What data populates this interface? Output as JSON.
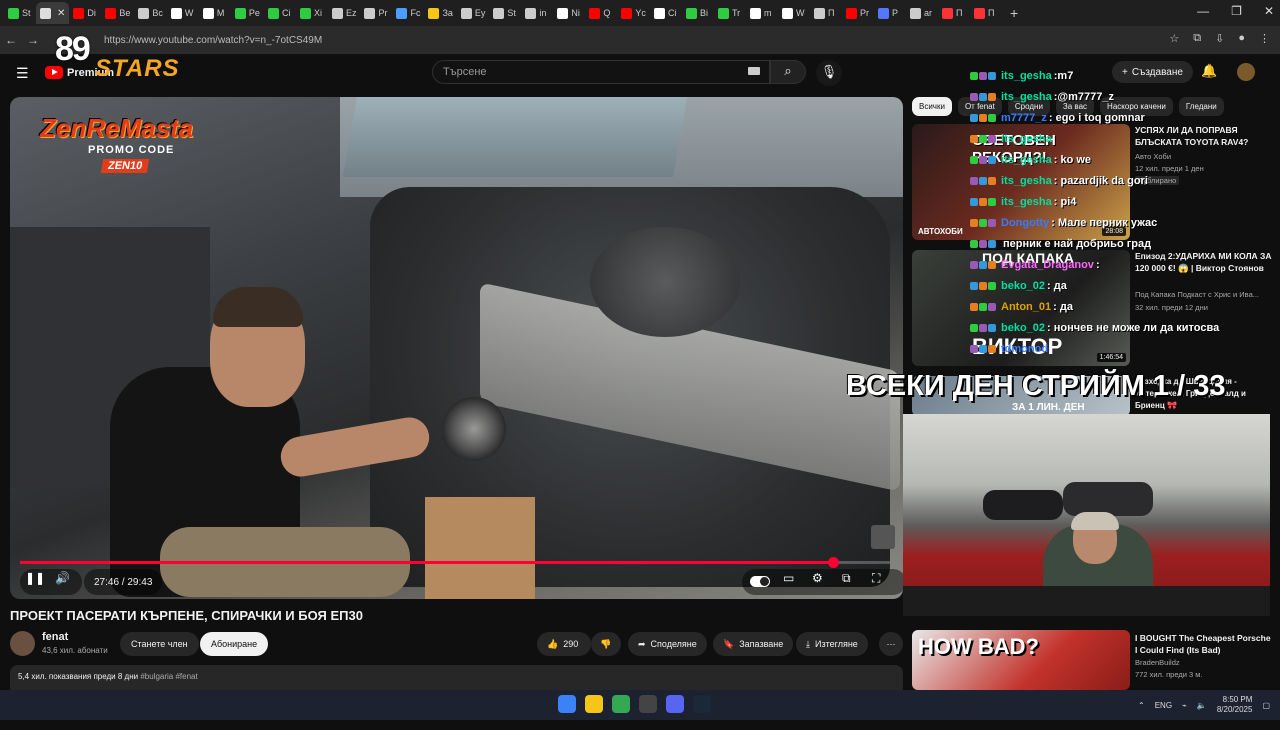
{
  "browser": {
    "tabs": [
      {
        "label": "St",
        "color": "#2ecc40"
      },
      {
        "label": "",
        "color": "#dddddd",
        "active": true
      },
      {
        "label": "Di",
        "color": "#ff0000"
      },
      {
        "label": "Be",
        "color": "#ff0000"
      },
      {
        "label": "Bc",
        "color": "#cccccc"
      },
      {
        "label": "W",
        "color": "#ffffff"
      },
      {
        "label": "M",
        "color": "#ffffff"
      },
      {
        "label": "Pe",
        "color": "#2ecc40"
      },
      {
        "label": "Ci",
        "color": "#2ecc40"
      },
      {
        "label": "Xi",
        "color": "#2ecc40"
      },
      {
        "label": "Ez",
        "color": "#cccccc"
      },
      {
        "label": "Pr",
        "color": "#cccccc"
      },
      {
        "label": "Fc",
        "color": "#4a9eff"
      },
      {
        "label": "За",
        "color": "#f5c518"
      },
      {
        "label": "Ey",
        "color": "#cccccc"
      },
      {
        "label": "St",
        "color": "#cccccc"
      },
      {
        "label": "in",
        "color": "#cccccc"
      },
      {
        "label": "Ni",
        "color": "#ffffff"
      },
      {
        "label": "Q",
        "color": "#ff0000"
      },
      {
        "label": "Yc",
        "color": "#ff0000"
      },
      {
        "label": "Ci",
        "color": "#ffffff"
      },
      {
        "label": "Bi",
        "color": "#2ecc40"
      },
      {
        "label": "Tr",
        "color": "#2ecc40"
      },
      {
        "label": "m",
        "color": "#ffffff"
      },
      {
        "label": "W",
        "color": "#ffffff"
      },
      {
        "label": "П",
        "color": "#cccccc"
      },
      {
        "label": "Pr",
        "color": "#ff0000"
      },
      {
        "label": "Р",
        "color": "#5577ff"
      },
      {
        "label": "ar",
        "color": "#cccccc"
      },
      {
        "label": "П",
        "color": "#ff3333"
      },
      {
        "label": "П",
        "color": "#ff3333"
      }
    ],
    "url": "https://www.youtube.com/watch?v=n_-7otCS49M"
  },
  "youtube": {
    "logo_text": "Premium",
    "search_placeholder": "Търсене",
    "create_label": "Създаване"
  },
  "stream_overlay": {
    "logo_number": "89",
    "logo_word": "STARS",
    "promo_title": "ZenReMasta",
    "promo_sub": "PROMO CODE",
    "promo_code": "ZEN10",
    "banner": "ВСЕКИ ДЕН СТРИЙМ 1 / 33"
  },
  "player": {
    "time": "27:46 / 29:43",
    "progress_fraction": 0.934
  },
  "video": {
    "title": "ПРОЕКТ ПАСЕРАТИ КЪРПЕНЕ, СПИРАЧКИ И БОЯ ЕП30",
    "channel": "fenat",
    "subscribers": "43,6 хил. абонати",
    "join_label": "Станете член",
    "subscribe_label": "Абониране",
    "likes": "290",
    "share_label": "Споделяне",
    "save_label": "Запазване",
    "download_label": "Изтегляне",
    "views": "5,4 хил. показвания  преди 8 дни",
    "hashtags": "#bulgaria #fenat"
  },
  "sidebar": {
    "chips": [
      "Всички",
      "От fenat",
      "Сродни",
      "За вас",
      "Наскоро качени",
      "Гледани"
    ],
    "recs": [
      {
        "title": "УСПЯХ ЛИ ДА ПОПРАВЯ БЛЪСКАТА TOYOTA RAV4?",
        "channel": "Авто Хоби",
        "meta": "12 хил.  преди 1 ден",
        "badge": "Дублирано",
        "duration": "28:08",
        "thumb_text": "СВЕТОВЕН РЕКОРД?!",
        "thumb_label": "АВТОХОБИ"
      },
      {
        "title": "Епизод 2:УДАРИХА МИ КОЛА ЗА 120 000 €! 😱 | Виктор Стоянов",
        "channel": "Под Капака Подкаст с Хрис и Ива...",
        "meta": "32 хил.  преди 12 дни",
        "duration": "1:46:54",
        "thumb_text": "ПОД КАПАКА",
        "thumb_label": "ВИКТОР"
      },
      {
        "title": "Разходка до Швейцария - Интерлакен, Гринделвалд и Бриенц 🎀",
        "thumb_text": "ЗА 1 ЛИН. ДЕН"
      },
      {
        "title": "I BOUGHT The Cheapest Porsche I Could Find (Its Bad)",
        "channel": "BradenBuildz",
        "meta": "772 хил.  преди 3 м.",
        "thumb_text": "HOW BAD?"
      }
    ]
  },
  "chat": [
    {
      "user": "its_gesha",
      "text": ":m7"
    },
    {
      "user": "its_gesha",
      "text": ":@m7777_z"
    },
    {
      "user": "m7777_z",
      "text": ": ego i toq gomnar",
      "color": "#3a7bff"
    },
    {
      "user": "its_gesha",
      "text": ""
    },
    {
      "user": "its_gesha",
      "text": ": ko we"
    },
    {
      "user": "its_gesha",
      "text": ": pazardjik da gori"
    },
    {
      "user": "its_gesha",
      "text": ": pi4"
    },
    {
      "user": "Dongotty",
      "text": ": Мале перник ужас",
      "color": "#3a7bff"
    },
    {
      "user": "",
      "text": "перник е най добриьо град",
      "color": "#3a7bff"
    },
    {
      "user": "Evgata_Draganov",
      "text": ":",
      "color": "#ff66ff"
    },
    {
      "user": "beko_02",
      "text": ": да"
    },
    {
      "user": "Anton_01",
      "text": ": да",
      "color": "#e0a000"
    },
    {
      "user": "beko_02",
      "text": ": нончев не може ли да китосва"
    },
    {
      "user": "tdmonod",
      "text": "",
      "color": "#3a7bff"
    }
  ],
  "taskbar": {
    "lang": "ENG",
    "time": "8:50 PM",
    "date": "8/20/2025"
  }
}
